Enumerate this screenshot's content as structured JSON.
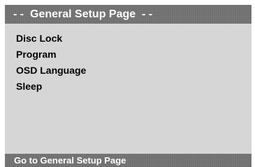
{
  "header": {
    "title": "- -  General Setup Page  - -"
  },
  "menu": {
    "items": [
      {
        "label": "Disc Lock"
      },
      {
        "label": "Program"
      },
      {
        "label": "OSD Language"
      },
      {
        "label": "Sleep"
      }
    ]
  },
  "footer": {
    "status_text": "Go to General Setup Page"
  },
  "colors": {
    "header_bg": "#6e6e6e",
    "panel_bg": "#d6d6d6",
    "header_text": "#ffffff",
    "item_text": "#000000"
  }
}
